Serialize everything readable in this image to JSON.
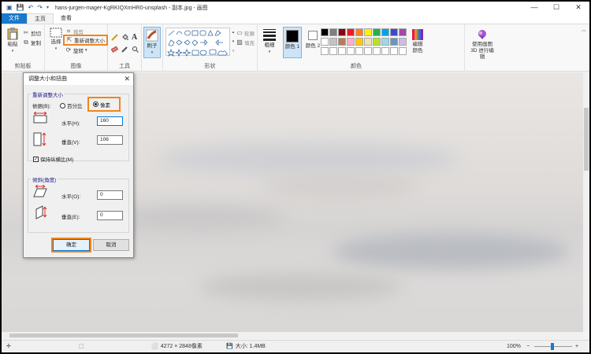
{
  "window": {
    "title": "hans-jurgen-mager-KgRKIQXmHR0-unsplash - 副本.jpg - 画图",
    "minimize": "—",
    "maximize": "☐",
    "close": "✕"
  },
  "tabs": [
    "文件",
    "主页",
    "查看"
  ],
  "ribbon": {
    "clipboard": {
      "label": "剪贴板",
      "paste": "粘贴",
      "cut": "剪切",
      "copy": "复制"
    },
    "image": {
      "label": "图像",
      "select": "选择",
      "crop": "裁剪",
      "resize": "重新调整大小",
      "rotate": "旋转"
    },
    "tools": {
      "label": "工具"
    },
    "brushes": {
      "label": "刷子"
    },
    "shapes": {
      "label": "形状",
      "outline": "轮廓",
      "fill": "填充"
    },
    "size": {
      "label": "粗细"
    },
    "colors": {
      "label": "颜色",
      "color1": "颜色 1",
      "color2": "颜色 2",
      "edit": "编辑颜色",
      "paint3d": "使用画图 3D 进行编辑",
      "palette": [
        "#000000",
        "#7f7f7f",
        "#880015",
        "#ed1c24",
        "#ff7f27",
        "#fff200",
        "#22b14c",
        "#00a2e8",
        "#3f48cc",
        "#a349a4",
        "#ffffff",
        "#c3c3c3",
        "#b97a57",
        "#ffaec9",
        "#ffc90e",
        "#efe4b0",
        "#b5e61d",
        "#99d9ea",
        "#7092be",
        "#c8bfe7",
        "#ffffff",
        "#ffffff",
        "#ffffff",
        "#ffffff",
        "#ffffff",
        "#ffffff",
        "#ffffff",
        "#ffffff",
        "#ffffff",
        "#ffffff"
      ]
    }
  },
  "dialog": {
    "title": "调整大小和扭曲",
    "close": "✕",
    "resize_legend": "重新调整大小",
    "by_label": "依据(B):",
    "percent": "百分比",
    "pixels": "像素",
    "horizontal_label": "水平(H):",
    "horizontal_value": "160",
    "vertical_label": "垂直(V):",
    "vertical_value": "106",
    "keep_ratio": "保持纵横比(M)",
    "skew_legend": "倾斜(角度)",
    "skew_h_label": "水平(O):",
    "skew_h_value": "0",
    "skew_v_label": "垂直(E):",
    "skew_v_value": "0",
    "ok": "确定",
    "cancel": "取消"
  },
  "status": {
    "dimensions": "4272 × 2848像素",
    "size": "大小: 1.4MB",
    "zoom": "100%",
    "zoom_minus": "−",
    "zoom_plus": "+"
  }
}
